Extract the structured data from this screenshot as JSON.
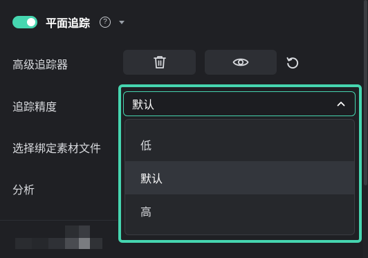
{
  "header": {
    "title": "平面追踪",
    "toggle_on": true,
    "help_glyph": "?",
    "icons": [
      "toggle-switch",
      "help-icon",
      "caret-down-icon"
    ]
  },
  "rows": {
    "advanced_tracker_label": "高级追踪器",
    "precision_label": "追踪精度",
    "bind_file_label": "选择绑定素材文件",
    "analyze_label": "分析"
  },
  "tools": {
    "icons": [
      "trash-icon",
      "eye-icon",
      "reset-icon"
    ]
  },
  "precision_select": {
    "value": "默认",
    "expanded": true,
    "options": [
      {
        "label": "低",
        "selected": false
      },
      {
        "label": "默认",
        "selected": true
      },
      {
        "label": "高",
        "selected": false
      }
    ]
  },
  "colors": {
    "accent": "#46d6b0",
    "background": "#1f2024",
    "dropdown_bg": "#26282c",
    "selected_bg": "#33363c"
  }
}
